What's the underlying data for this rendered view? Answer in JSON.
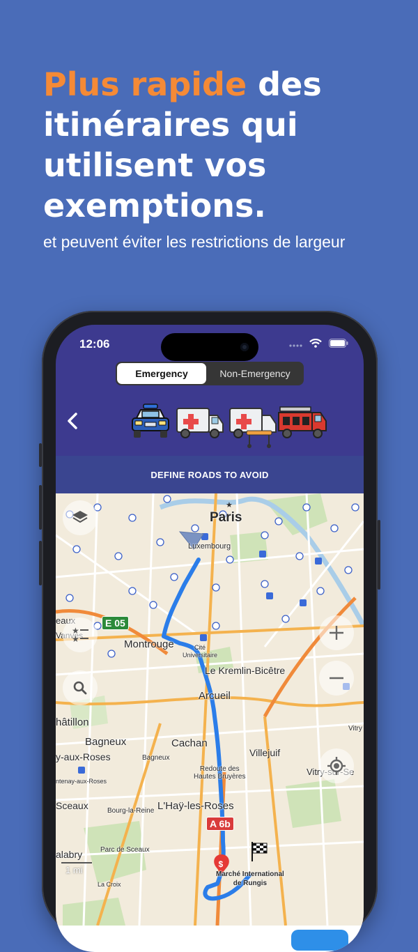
{
  "headline": {
    "accent": "Plus rapide",
    "line1_rest": " des",
    "line2": "itinéraires qui",
    "line3": "utilisent vos",
    "line4": "exemptions."
  },
  "subheadline": "et peuvent éviter les restrictions de largeur",
  "status_bar": {
    "time": "12:06"
  },
  "mode_toggle": {
    "options": [
      "Emergency",
      "Non-Emergency"
    ],
    "selected": "Emergency"
  },
  "vehicles": [
    "police-car-icon",
    "ambulance-icon",
    "ambulance-stretcher-icon",
    "fire-truck-icon"
  ],
  "avoid_bar": {
    "label": "DEFINE ROADS TO AVOID"
  },
  "map": {
    "labels": {
      "paris": "Paris",
      "luxembourg": "Luxembourg",
      "montrouge": "Montrouge",
      "cite_universitaire": "Cité\nUniversitaire",
      "kremlin": "Le Kremlin-Bicêtre",
      "arcueil": "Arcueil",
      "chatillon": "hâtillon",
      "bagneux_big": "Bagneux",
      "bagneux_small": "Bagneux",
      "cachan": "Cachan",
      "fontenay": "y-aux-Roses",
      "fontenay_small": "ntenay-aux-Roses",
      "villejuif": "Villejuif",
      "redoute": "Redoute des\nHautes Bruyères",
      "vitry": "Vitry-sur-Se",
      "vitry_small": "Vitry",
      "sceaux": "Sceaux",
      "bourg": "Bourg-la-Reine",
      "lhay": "L'Haÿ-les-Roses",
      "parc": "Parc de Sceaux",
      "malabry": "alabry",
      "lacroix": "La Croix",
      "rungis": "Marché International\nde Rungis",
      "vanves": "Vanves",
      "eaux": "eaux"
    },
    "road_shields": {
      "e05": "E 05",
      "a6b": "A 6b"
    },
    "scale": "1 mi",
    "controls": [
      "layers-icon",
      "route-options-icon",
      "search-icon",
      "zoom-in-icon",
      "zoom-out-icon",
      "locate-icon"
    ]
  },
  "colors": {
    "background": "#4a6cb8",
    "accent": "#f58a36",
    "route": "#2b7de9",
    "toolbar": "#3d3a8f"
  }
}
